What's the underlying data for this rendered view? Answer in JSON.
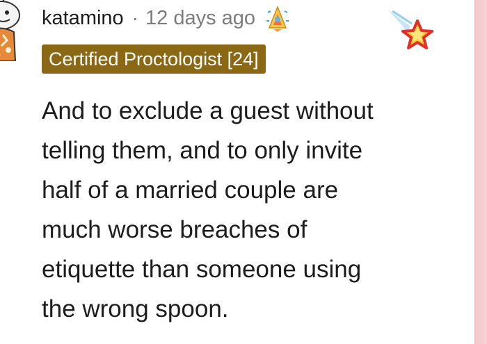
{
  "comment": {
    "username": "katamino",
    "separator": "·",
    "timestamp": "12 days ago",
    "flair": "Certified Proctologist [24]",
    "lines": [
      "And to exclude a guest without",
      "telling them, and to only invite",
      "half of a married couple are",
      "much worse breaches of",
      "etiquette than someone using",
      "the wrong spoon."
    ],
    "flair_color": "#8b6914",
    "text_color": "#1c1c1c",
    "meta_color": "#7c7c7c",
    "icons": {
      "avatar": "snoo-avatar",
      "award_small": "rocket-award-icon",
      "award_large": "shooting-star-award-icon"
    }
  }
}
